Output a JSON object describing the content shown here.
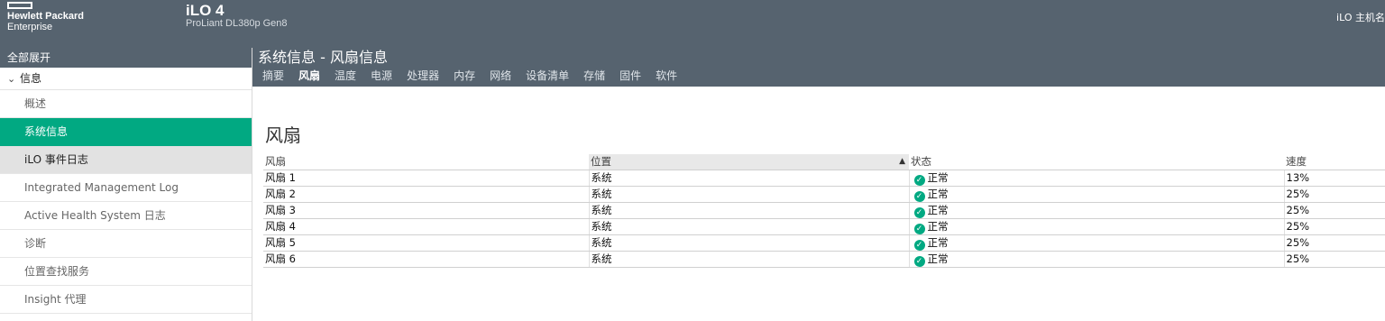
{
  "brand": {
    "line1": "Hewlett Packard",
    "line2": "Enterprise"
  },
  "app": {
    "title": "iLO 4",
    "subtitle": "ProLiant DL380p Gen8",
    "host_label": "iLO 主机名"
  },
  "sidebar": {
    "expand_all": "全部展开",
    "section": "信息",
    "items": [
      {
        "label": "概述"
      },
      {
        "label": "系统信息"
      },
      {
        "label": "iLO 事件日志"
      },
      {
        "label": "Integrated Management Log"
      },
      {
        "label": "Active Health System 日志"
      },
      {
        "label": "诊断"
      },
      {
        "label": "位置查找服务"
      },
      {
        "label": "Insight 代理"
      }
    ]
  },
  "header": {
    "title": "系统信息 - 风扇信息",
    "tabs": [
      "摘要",
      "风扇",
      "温度",
      "电源",
      "处理器",
      "内存",
      "网络",
      "设备清单",
      "存储",
      "固件",
      "软件"
    ],
    "active_tab": "风扇"
  },
  "fans": {
    "title": "风扇",
    "columns": [
      "风扇",
      "位置",
      "状态",
      "速度"
    ],
    "rows": [
      {
        "name": "风扇 1",
        "location": "系统",
        "status": "正常",
        "speed": "13%"
      },
      {
        "name": "风扇 2",
        "location": "系统",
        "status": "正常",
        "speed": "25%"
      },
      {
        "name": "风扇 3",
        "location": "系统",
        "status": "正常",
        "speed": "25%"
      },
      {
        "name": "风扇 4",
        "location": "系统",
        "status": "正常",
        "speed": "25%"
      },
      {
        "name": "风扇 5",
        "location": "系统",
        "status": "正常",
        "speed": "25%"
      },
      {
        "name": "风扇 6",
        "location": "系统",
        "status": "正常",
        "speed": "25%"
      }
    ]
  },
  "colors": {
    "header_bg": "#56636f",
    "accent": "#01a982"
  },
  "icons": {
    "status_ok": "check-circle-icon",
    "sort": "sort-ascending-icon",
    "section": "chevron-down-icon"
  }
}
